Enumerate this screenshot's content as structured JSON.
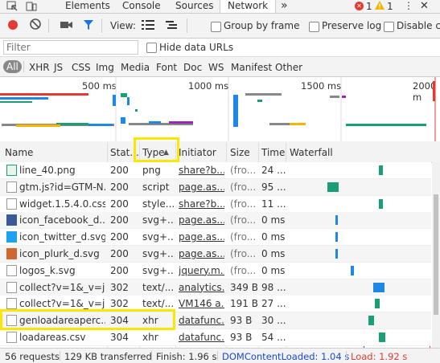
{
  "tabs": {
    "items": [
      "Elements",
      "Console",
      "Sources",
      "Network"
    ],
    "more": "»",
    "errors": "1",
    "warnings": "1"
  },
  "toolbar": {
    "view_label": "View:",
    "group_by_frame": "Group by frame",
    "preserve_log": "Preserve log",
    "disable_cache": "Disable ca"
  },
  "filter": {
    "placeholder": "Filter",
    "hide_data_urls": "Hide data URLs"
  },
  "types": [
    "All",
    "XHR",
    "JS",
    "CSS",
    "Img",
    "Media",
    "Font",
    "Doc",
    "WS",
    "Manifest",
    "Other"
  ],
  "overview": {
    "ticks": [
      "500 ms",
      "1000 ms",
      "1500 ms",
      "2000 m"
    ]
  },
  "columns": {
    "name": "Name",
    "status": "Stat...",
    "type": "Type",
    "initiator": "Initiator",
    "size": "Size",
    "time": "Time",
    "waterfall": "Waterfall"
  },
  "rows": [
    {
      "name": "line_40.png",
      "status": "200",
      "type": "png",
      "initiator": "share?b...",
      "size": "(fro...",
      "time": "24 ...",
      "icon": "image-icon",
      "bar_start": 0.53,
      "bar_width": 0.015,
      "bar_color": "#1a9e77"
    },
    {
      "name": "gtm.js?id=GTM-N...",
      "status": "200",
      "type": "script",
      "initiator": "page.as...",
      "size": "(fro...",
      "time": "95 ...",
      "icon": "file-icon",
      "bar_start": 0.17,
      "bar_width": 0.04,
      "bar_color": "#1a9e77"
    },
    {
      "name": "widget.1.5.4.0.css",
      "status": "200",
      "type": "style...",
      "initiator": "share?b...",
      "size": "(fro...",
      "time": "11 ...",
      "icon": "file-icon",
      "bar_start": 0.53,
      "bar_width": 0.015,
      "bar_color": "#1a9e77"
    },
    {
      "name": "icon_facebook_d...",
      "status": "200",
      "type": "svg+...",
      "initiator": "page.as...",
      "size": "(fro...",
      "time": "0 ms",
      "icon": "facebook-icon",
      "bar_start": 0.225,
      "bar_width": 0.01,
      "bar_color": "#1e88e5"
    },
    {
      "name": "icon_twitter_d.svg",
      "status": "200",
      "type": "svg+...",
      "initiator": "page.as...",
      "size": "(fro...",
      "time": "0 ms",
      "icon": "twitter-icon",
      "bar_start": 0.225,
      "bar_width": 0.01,
      "bar_color": "#1e88e5"
    },
    {
      "name": "icon_plurk_d.svg",
      "status": "200",
      "type": "svg+...",
      "initiator": "page.as...",
      "size": "(fro...",
      "time": "0 ms",
      "icon": "plurk-icon",
      "bar_start": 0.225,
      "bar_width": 0.01,
      "bar_color": "#1e88e5"
    },
    {
      "name": "logos_k.svg",
      "status": "200",
      "type": "svg+...",
      "initiator": "jquery.m...",
      "size": "(fro...",
      "time": "0 ms",
      "icon": "file-icon",
      "bar_start": 0.335,
      "bar_width": 0.01,
      "bar_color": "#1e88e5"
    },
    {
      "name": "collect?v=1&_v=j...",
      "status": "302",
      "type": "text/...",
      "initiator": "analytics...",
      "size": "349 B",
      "time": "98 ...",
      "icon": "file-icon",
      "bar_start": 0.49,
      "bar_width": 0.04,
      "bar_color": "#1e88e5"
    },
    {
      "name": "collect?v=1&_v=j...",
      "status": "302",
      "type": "text/...",
      "initiator": "VM146 a...",
      "size": "191 B",
      "time": "27 ...",
      "icon": "file-icon",
      "bar_start": 0.505,
      "bar_width": 0.015,
      "bar_color": "#1a9e77"
    },
    {
      "name": "genloadareaperc...",
      "status": "304",
      "type": "xhr",
      "initiator": "datafunc...",
      "size": "93 B",
      "time": "30 ...",
      "icon": "file-icon",
      "bar_start": 0.46,
      "bar_width": 0.018,
      "bar_color": "#1a9e77"
    },
    {
      "name": "loadareas.csv",
      "status": "304",
      "type": "xhr",
      "initiator": "datafunc...",
      "size": "93 B",
      "time": "54 ...",
      "icon": "file-icon",
      "bar_start": 0.53,
      "bar_width": 0.022,
      "bar_color": "#1a9e77"
    }
  ],
  "footer": {
    "requests": "56 requests",
    "transferred": "129 KB transferred",
    "finish": "Finish: 1.96 s",
    "dcl": "DOMContentLoaded: 1.04 s",
    "load": "Load: 1.92 s"
  },
  "colors": {
    "dcl_line": "#1a4ad1",
    "load_line": "#e53935",
    "highlight": "#ffe600",
    "record": "#e53935",
    "filter_active": "#1a73e8"
  }
}
